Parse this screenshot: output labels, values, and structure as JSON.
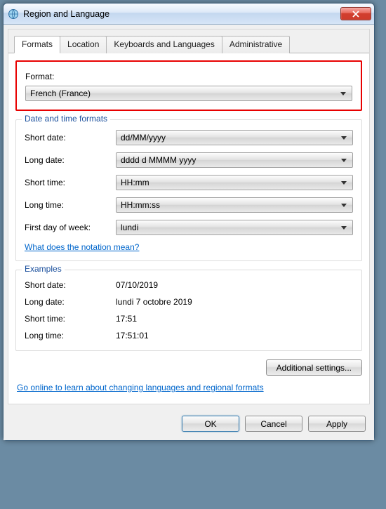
{
  "window": {
    "title": "Region and Language"
  },
  "tabs": {
    "items": [
      {
        "label": "Formats"
      },
      {
        "label": "Location"
      },
      {
        "label": "Keyboards and Languages"
      },
      {
        "label": "Administrative"
      }
    ],
    "active_index": 0
  },
  "format_group": {
    "label": "Format:",
    "value": "French (France)"
  },
  "date_time_group": {
    "legend": "Date and time formats",
    "rows": [
      {
        "label": "Short date:",
        "value": "dd/MM/yyyy"
      },
      {
        "label": "Long date:",
        "value": "dddd d MMMM yyyy"
      },
      {
        "label": "Short time:",
        "value": "HH:mm"
      },
      {
        "label": "Long time:",
        "value": "HH:mm:ss"
      },
      {
        "label": "First day of week:",
        "value": "lundi"
      }
    ],
    "notation_link": "What does the notation mean?"
  },
  "examples_group": {
    "legend": "Examples",
    "rows": [
      {
        "label": "Short date:",
        "value": "07/10/2019"
      },
      {
        "label": "Long date:",
        "value": "lundi 7 octobre 2019"
      },
      {
        "label": "Short time:",
        "value": "17:51"
      },
      {
        "label": "Long time:",
        "value": "17:51:01"
      }
    ]
  },
  "buttons": {
    "additional": "Additional settings...",
    "online_link": "Go online to learn about changing languages and regional formats",
    "ok": "OK",
    "cancel": "Cancel",
    "apply": "Apply"
  }
}
